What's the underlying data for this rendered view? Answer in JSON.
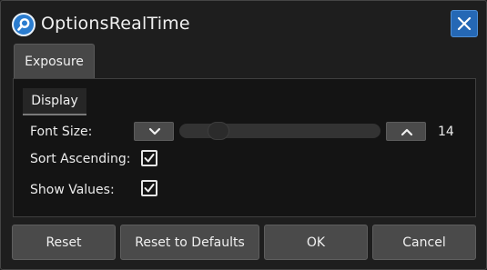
{
  "window": {
    "title": "OptionsRealTime",
    "app_icon": "search-app-icon",
    "close_icon": "close-icon",
    "accent_color": "#2568b5"
  },
  "tabs": [
    {
      "label": "Exposure",
      "selected": true
    }
  ],
  "section": {
    "label": "Display"
  },
  "settings": {
    "font_size": {
      "label": "Font Size:",
      "value": "14",
      "decrement_icon": "chevron-down-icon",
      "increment_icon": "chevron-up-icon"
    },
    "sort_ascending": {
      "label": "Sort Ascending:",
      "checked": true
    },
    "show_values": {
      "label": "Show Values:",
      "checked": true
    }
  },
  "footer": {
    "reset_label": "Reset",
    "reset_defaults_label": "Reset to Defaults",
    "ok_label": "OK",
    "cancel_label": "Cancel"
  }
}
